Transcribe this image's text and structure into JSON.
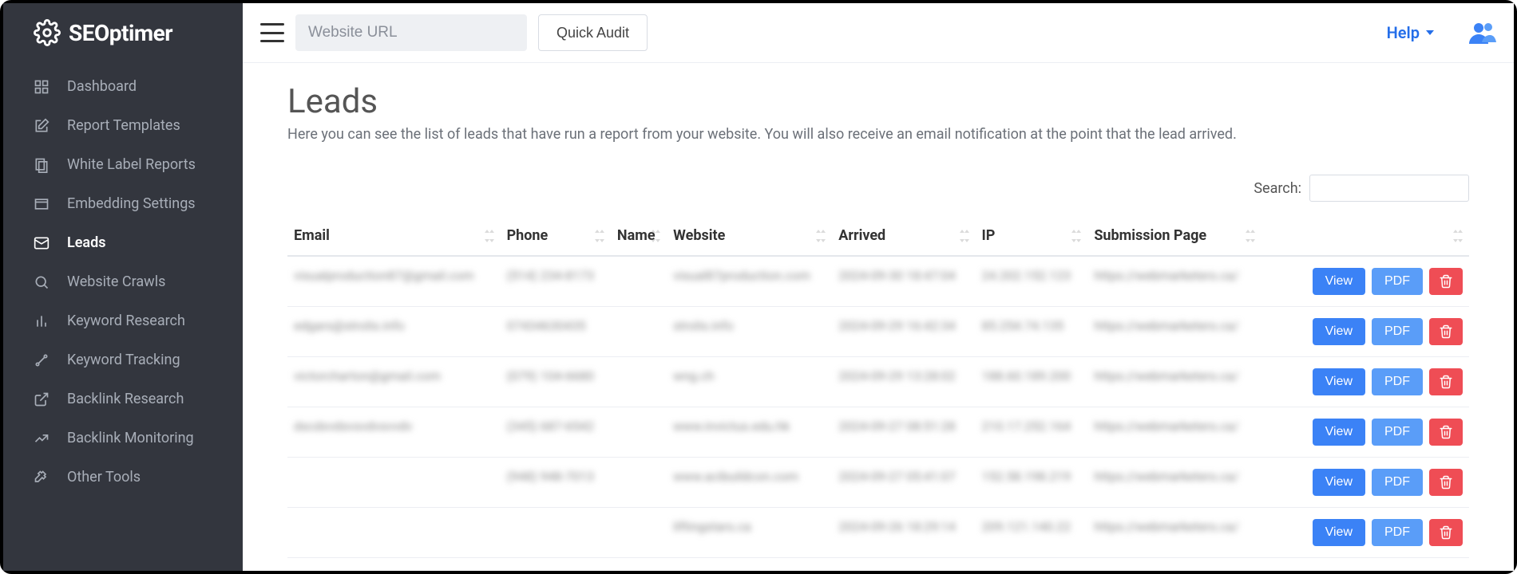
{
  "brand": "SEOptimer",
  "topbar": {
    "url_placeholder": "Website URL",
    "quick_audit": "Quick Audit",
    "help": "Help"
  },
  "sidebar": {
    "items": [
      {
        "id": "dashboard",
        "label": "Dashboard",
        "icon": "dashboard-icon"
      },
      {
        "id": "report-templates",
        "label": "Report Templates",
        "icon": "templates-icon"
      },
      {
        "id": "white-label",
        "label": "White Label Reports",
        "icon": "whitelabel-icon"
      },
      {
        "id": "embedding",
        "label": "Embedding Settings",
        "icon": "embed-icon"
      },
      {
        "id": "leads",
        "label": "Leads",
        "icon": "mail-icon",
        "active": true
      },
      {
        "id": "crawls",
        "label": "Website Crawls",
        "icon": "search-icon"
      },
      {
        "id": "kw-research",
        "label": "Keyword Research",
        "icon": "bars-icon"
      },
      {
        "id": "kw-tracking",
        "label": "Keyword Tracking",
        "icon": "tracking-icon"
      },
      {
        "id": "backlink-research",
        "label": "Backlink Research",
        "icon": "external-icon"
      },
      {
        "id": "backlink-monitoring",
        "label": "Backlink Monitoring",
        "icon": "trend-icon"
      },
      {
        "id": "other-tools",
        "label": "Other Tools",
        "icon": "tools-icon"
      }
    ]
  },
  "page": {
    "title": "Leads",
    "subtitle": "Here you can see the list of leads that have run a report from your website. You will also receive an email notification at the point that the lead arrived.",
    "search_label": "Search:"
  },
  "table": {
    "columns": [
      "Email",
      "Phone",
      "Name",
      "Website",
      "Arrived",
      "IP",
      "Submission Page"
    ],
    "view_label": "View",
    "pdf_label": "PDF",
    "rows": [
      {
        "email": "visualproduction87@gmail.com",
        "phone": "(514) 234-8173",
        "name": "",
        "website": "visual87production.com",
        "arrived": "2024-09-30 18:47:04",
        "ip": "24.202.152.123",
        "submission": "https://webmarketers.ca/"
      },
      {
        "email": "edgars@strolis.info",
        "phone": "07434630435",
        "name": "",
        "website": "strolis.info",
        "arrived": "2024-09-29 16:42:34",
        "ip": "85.254.74.135",
        "submission": "https://webmarketers.ca/"
      },
      {
        "email": "victorcharton@gmail.com",
        "phone": "(079) 104-6680",
        "name": "",
        "website": "wng.ch",
        "arrived": "2024-09-29 13:28:02",
        "ip": "188.60.189.200",
        "submission": "https://webmarketers.ca/"
      },
      {
        "email": "dscdxvdsvsvdvsvvdv",
        "phone": "(345) 687-6542",
        "name": "",
        "website": "www.invictus.edu.hk",
        "arrived": "2024-09-27 08:51:28",
        "ip": "210.17.252.164",
        "submission": "https://webmarketers.ca/"
      },
      {
        "email": "",
        "phone": "(948) 948-7013",
        "name": "",
        "website": "www.acibuildcon.com",
        "arrived": "2024-09-27 05:41:07",
        "ip": "152.58.198.219",
        "submission": "https://webmarketers.ca/"
      },
      {
        "email": "",
        "phone": "",
        "name": "",
        "website": "liftingstars.ca",
        "arrived": "2024-09-26 18:29:14",
        "ip": "209.121.140.22",
        "submission": "https://webmarketers.ca/"
      }
    ]
  }
}
